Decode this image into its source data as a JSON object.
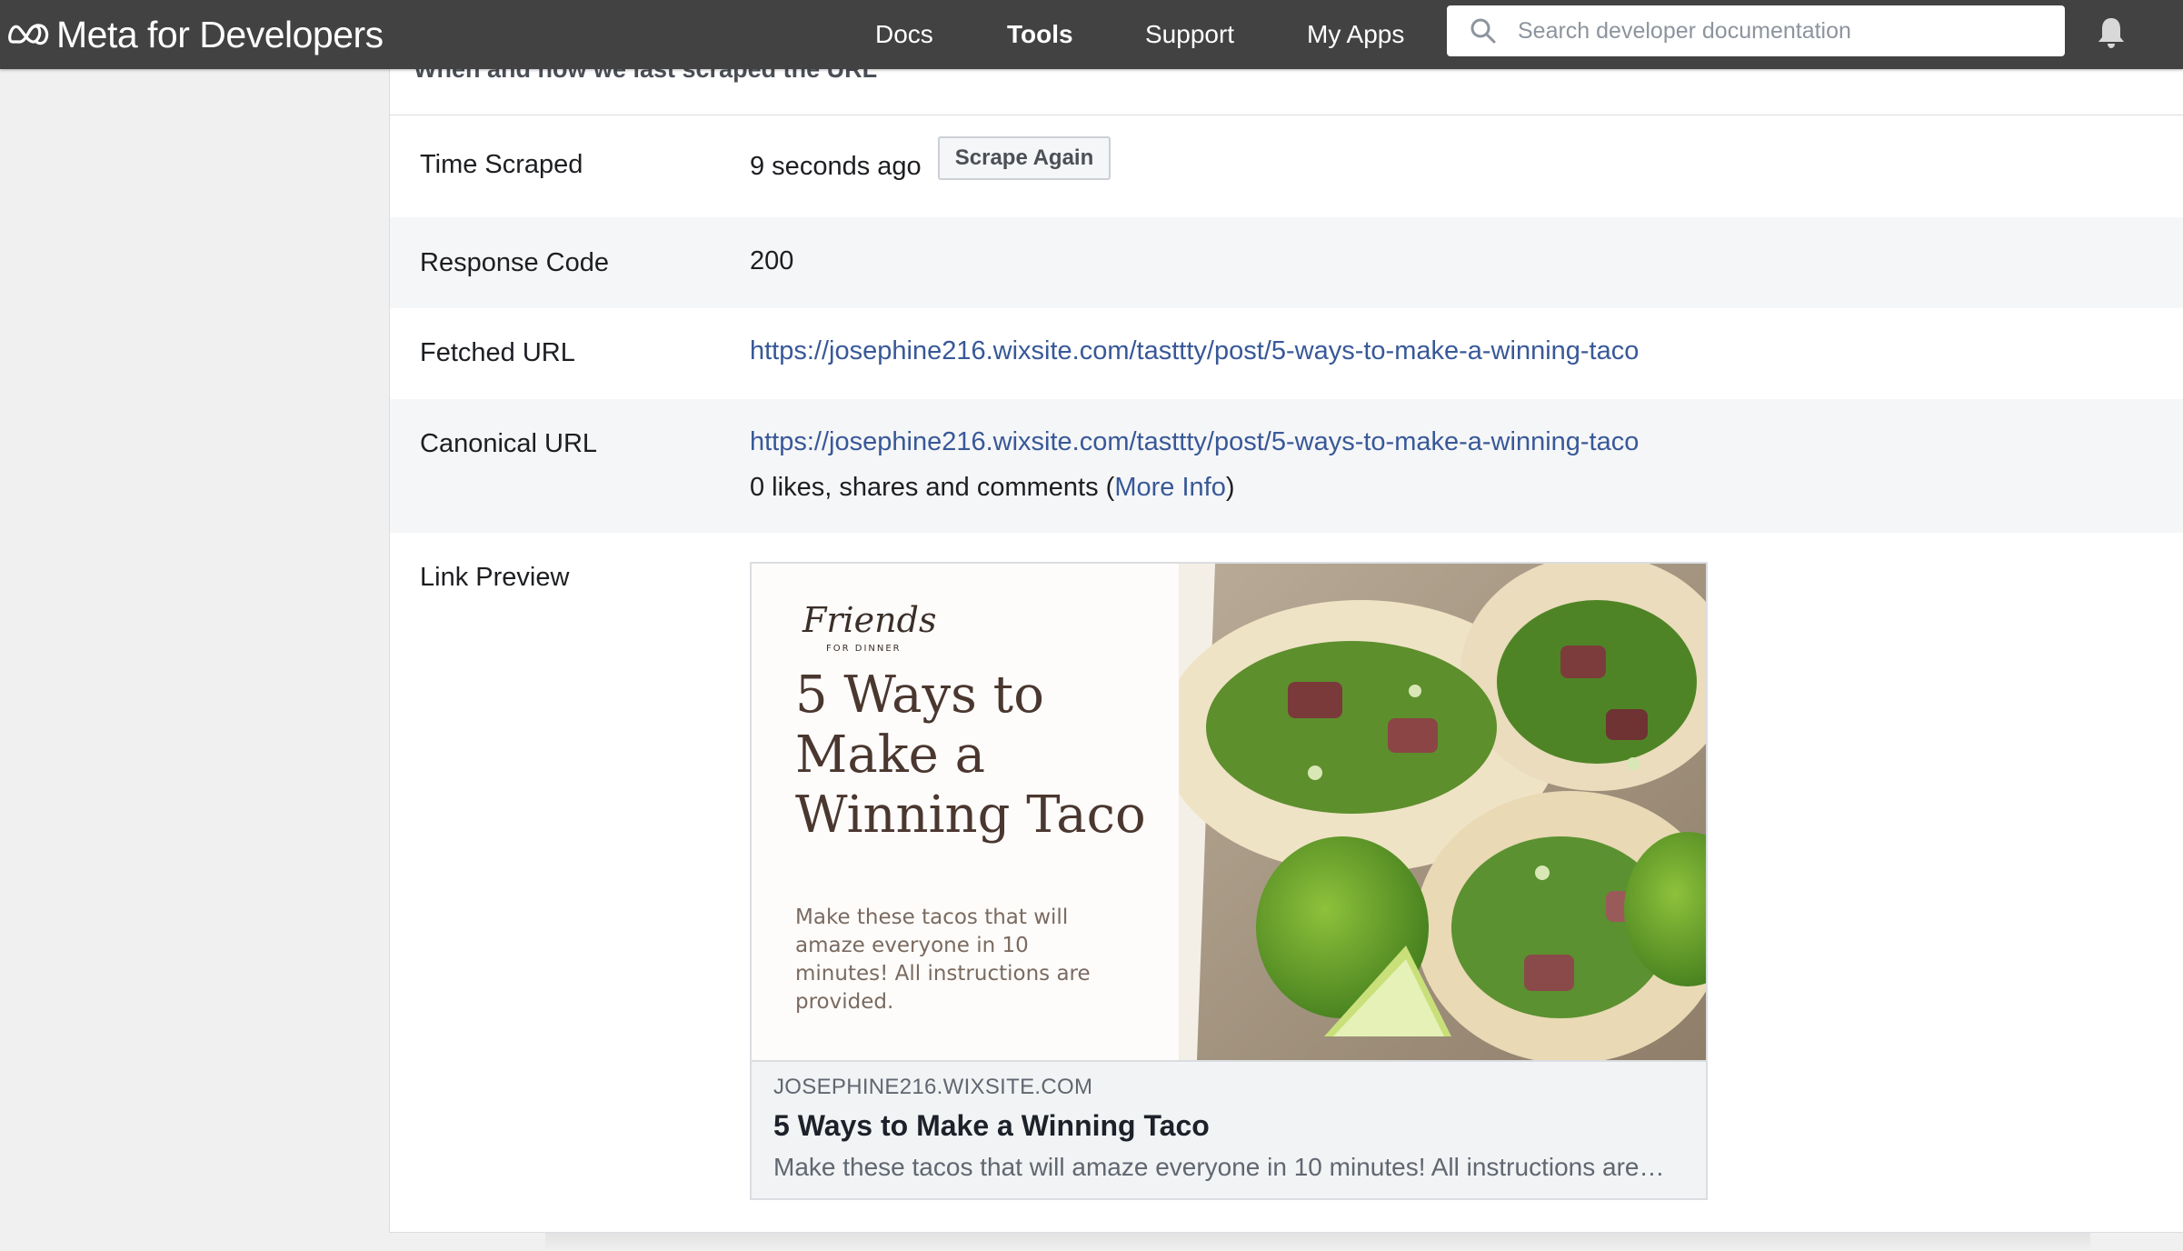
{
  "nav": {
    "brand": "Meta for Developers",
    "items": [
      {
        "label": "Docs"
      },
      {
        "label": "Tools"
      },
      {
        "label": "Support"
      },
      {
        "label": "My Apps"
      }
    ],
    "search_placeholder": "Search developer documentation"
  },
  "section": {
    "subtitle": "When and how we last scraped the URL"
  },
  "rows": {
    "time_scraped": {
      "label": "Time Scraped",
      "value": "9 seconds ago",
      "button": "Scrape Again"
    },
    "response_code": {
      "label": "Response Code",
      "value": "200"
    },
    "fetched_url": {
      "label": "Fetched URL",
      "value": "https://josephine216.wixsite.com/tasttty/post/5-ways-to-make-a-winning-taco"
    },
    "canonical_url": {
      "label": "Canonical URL",
      "value": "https://josephine216.wixsite.com/tasttty/post/5-ways-to-make-a-winning-taco",
      "engagement_prefix": "0 likes, shares and comments (",
      "more_info": "More Info",
      "engagement_suffix": ")"
    },
    "link_preview": {
      "label": "Link Preview"
    }
  },
  "preview": {
    "image": {
      "brand": "Friends",
      "brand_sub": "FOR DINNER",
      "heading": "5 Ways to Make a Winning Taco",
      "subtext": "Make these tacos that will amaze everyone in 10 minutes! All instructions are provided."
    },
    "domain": "JOSEPHINE216.WIXSITE.COM",
    "title": "5 Ways to Make a Winning Taco",
    "description": "Make these tacos that will amaze everyone in 10 minutes! All instructions are…"
  },
  "colors": {
    "topbar": "#424242",
    "link": "#385898",
    "alt_row": "#f5f6f7"
  },
  "icons": [
    "meta-logo-icon",
    "search-icon",
    "bell-icon"
  ]
}
